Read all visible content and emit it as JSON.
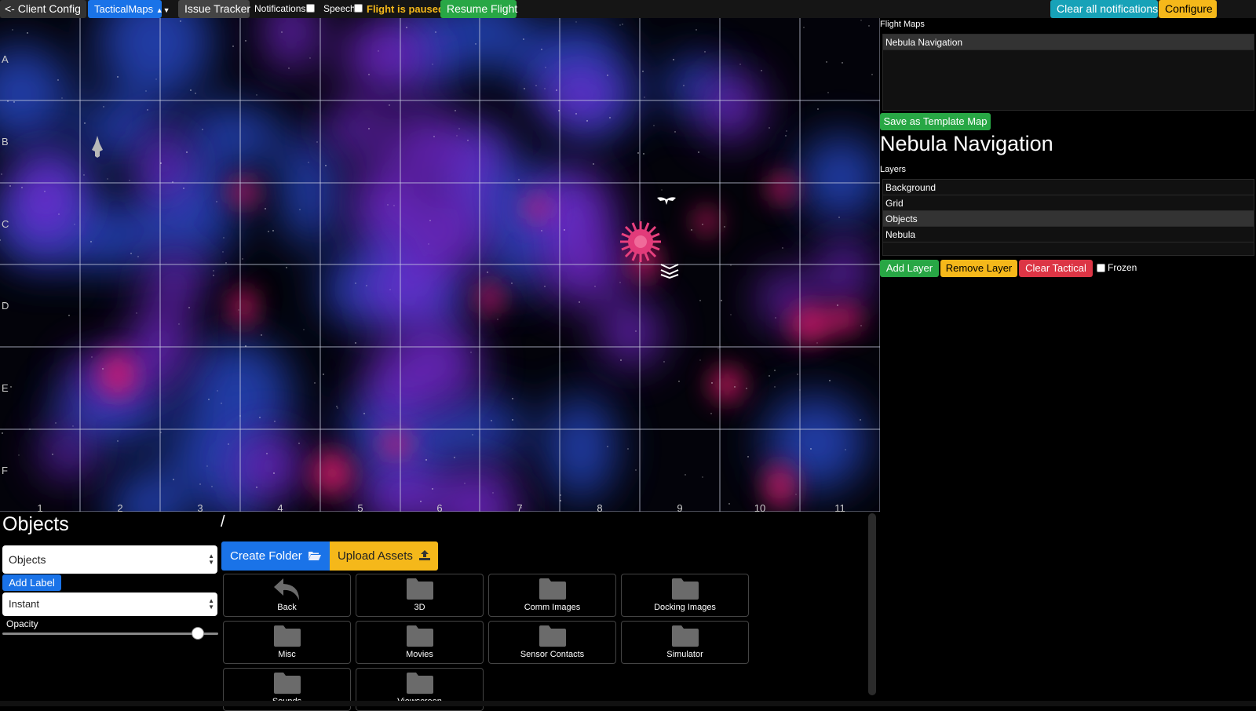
{
  "topbar": {
    "client_config": "<- Client Config",
    "tactical_maps": "TacticalMaps",
    "issue_tracker": "Issue Tracker",
    "notifications_label": "Notifications",
    "speech_label": "Speech",
    "flight_status": "Flight is paused",
    "resume_flight": "Resume Flight",
    "clear_notifications": "Clear all notifications",
    "configure": "Configure"
  },
  "map": {
    "rows": [
      "A",
      "B",
      "C",
      "D",
      "E",
      "F"
    ],
    "columns": [
      "1",
      "2",
      "3",
      "4",
      "5",
      "6",
      "7",
      "8",
      "9",
      "10",
      "11"
    ],
    "objects": [
      {
        "name": "ship-icon",
        "cell": "B2"
      },
      {
        "name": "bat-icon",
        "cell": "C9"
      },
      {
        "name": "star-icon",
        "cell": "C9"
      },
      {
        "name": "chevrons-icon",
        "cell": "D9"
      }
    ],
    "colors": {
      "nebula_blue": "#2a4fd8",
      "nebula_purple": "#7a2bd8",
      "nebula_magenta": "#d81a6a",
      "star": "#e23b7a"
    }
  },
  "right_panel": {
    "flight_maps_label": "Flight Maps",
    "flight_maps": [
      {
        "label": "Nebula Navigation",
        "selected": true
      }
    ],
    "save_template": "Save as Template Map",
    "map_title": "Nebula Navigation",
    "layers_label": "Layers",
    "layers": [
      {
        "label": "Background",
        "selected": false
      },
      {
        "label": "Grid",
        "selected": false
      },
      {
        "label": "Objects",
        "selected": true
      },
      {
        "label": "Nebula",
        "selected": false
      }
    ],
    "add_layer": "Add Layer",
    "remove_layer": "Remove Layer",
    "clear_tactical": "Clear Tactical",
    "frozen_label": "Frozen"
  },
  "bottom": {
    "title": "Objects",
    "path": "/",
    "layer_select": "Objects",
    "add_label": "Add Label",
    "speed_select": "Instant",
    "opacity_label": "Opacity",
    "opacity_value": 0.93,
    "create_folder": "Create Folder",
    "upload_assets": "Upload Assets",
    "tiles": [
      {
        "label": "Back",
        "icon": "back-arrow-icon"
      },
      {
        "label": "3D",
        "icon": "folder-icon"
      },
      {
        "label": "Comm Images",
        "icon": "folder-icon"
      },
      {
        "label": "Docking Images",
        "icon": "folder-icon"
      },
      {
        "label": "Misc",
        "icon": "folder-icon"
      },
      {
        "label": "Movies",
        "icon": "folder-icon"
      },
      {
        "label": "Sensor Contacts",
        "icon": "folder-icon"
      },
      {
        "label": "Simulator",
        "icon": "folder-icon"
      },
      {
        "label": "Sounds",
        "icon": "folder-icon"
      },
      {
        "label": "Viewscreen",
        "icon": "folder-icon"
      }
    ]
  }
}
